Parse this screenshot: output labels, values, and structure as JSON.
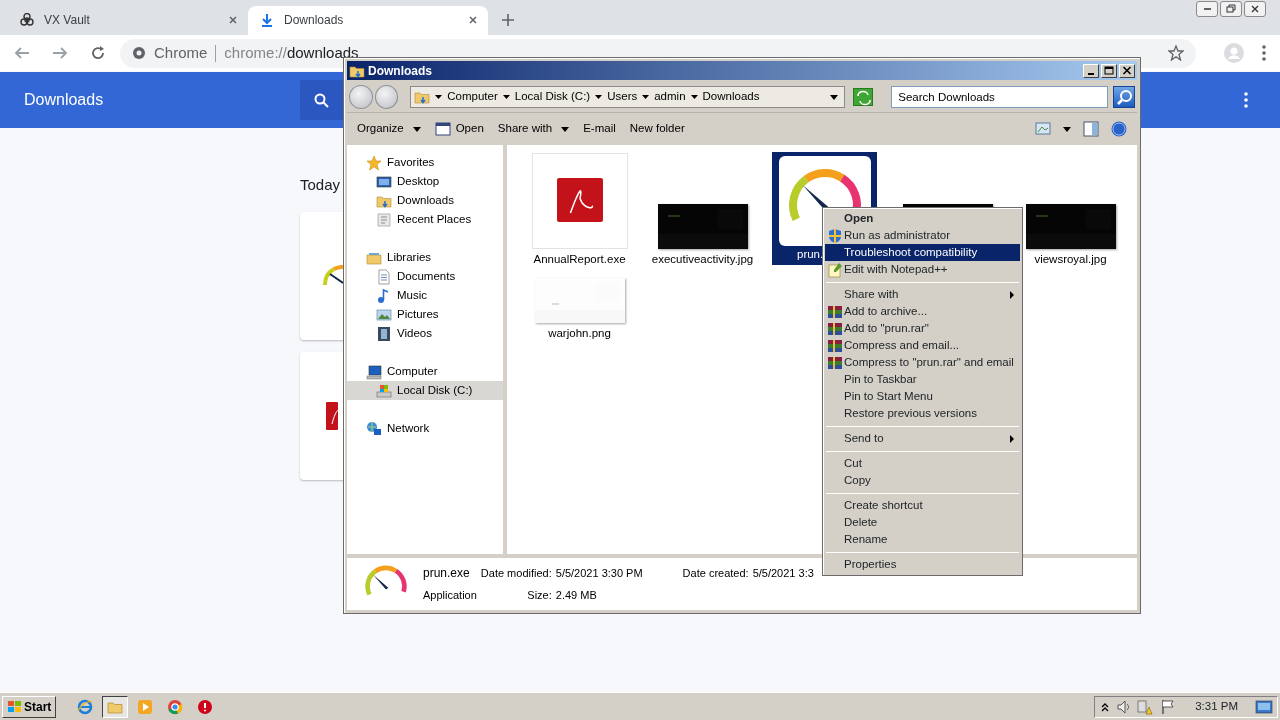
{
  "browser": {
    "tabs": [
      {
        "title": "VX Vault",
        "selected": false
      },
      {
        "title": "Downloads",
        "selected": true
      }
    ],
    "omnibox": {
      "origin": "Chrome",
      "scheme": "chrome://",
      "path": "downloads"
    }
  },
  "downloads_page": {
    "title": "Downloads",
    "section": "Today"
  },
  "explorer": {
    "title": "Downloads",
    "breadcrumb": [
      "Computer",
      "Local Disk (C:)",
      "Users",
      "admin",
      "Downloads"
    ],
    "search": {
      "placeholder": "Search Downloads"
    },
    "commands": [
      {
        "label": "Organize",
        "dropdown": true
      },
      {
        "label": "Open",
        "dropdown": false
      },
      {
        "label": "Share with",
        "dropdown": true
      },
      {
        "label": "E-mail",
        "dropdown": false
      },
      {
        "label": "New folder",
        "dropdown": false
      }
    ],
    "nav": [
      {
        "label": "Favorites",
        "selected": false,
        "children": [
          {
            "label": "Desktop",
            "selected": false
          },
          {
            "label": "Downloads",
            "selected": false
          },
          {
            "label": "Recent Places",
            "selected": false
          }
        ]
      },
      {
        "label": "Libraries",
        "selected": false,
        "children": [
          {
            "label": "Documents",
            "selected": false
          },
          {
            "label": "Music",
            "selected": false
          },
          {
            "label": "Pictures",
            "selected": false
          },
          {
            "label": "Videos",
            "selected": false
          }
        ]
      },
      {
        "label": "Computer",
        "selected": false,
        "children": [
          {
            "label": "Local Disk (C:)",
            "selected": true
          }
        ]
      },
      {
        "label": "Network",
        "selected": false
      }
    ],
    "files": [
      {
        "name": "AnnualReport.exe",
        "selected": false
      },
      {
        "name": "executiveactivity.jpg",
        "selected": false
      },
      {
        "name": "prun.",
        "selected": true
      },
      {
        "selected": false
      },
      {
        "name": "viewsroyal.jpg",
        "selected": false
      },
      {
        "name": "warjohn.png",
        "selected": false
      }
    ],
    "details": {
      "name": "prun.exe",
      "type": "Application",
      "fields": [
        {
          "label": "Date modified:",
          "value": "5/5/2021 3:30 PM"
        },
        {
          "label": "Size:",
          "value": "2.49 MB"
        },
        {
          "label": "Date created:",
          "value": "5/5/2021 3:3"
        }
      ]
    }
  },
  "context_menu": {
    "groups": [
      [
        {
          "label": "Open",
          "default": true,
          "selected": false
        },
        {
          "label": "Run as administrator",
          "selected": false
        },
        {
          "label": "Troubleshoot compatibility",
          "selected": true
        },
        {
          "label": "Edit with Notepad++",
          "selected": false
        }
      ],
      [
        {
          "label": "Share with",
          "submenu": true,
          "selected": false
        },
        {
          "label": "Add to archive...",
          "selected": false
        },
        {
          "label": "Add to \"prun.rar\"",
          "selected": false
        },
        {
          "label": "Compress and email...",
          "selected": false
        },
        {
          "label": "Compress to \"prun.rar\" and email",
          "selected": false
        },
        {
          "label": "Pin to Taskbar",
          "selected": false
        },
        {
          "label": "Pin to Start Menu",
          "selected": false
        },
        {
          "label": "Restore previous versions",
          "selected": false
        }
      ],
      [
        {
          "label": "Send to",
          "submenu": true,
          "selected": false
        }
      ],
      [
        {
          "label": "Cut",
          "selected": false
        },
        {
          "label": "Copy",
          "selected": false
        }
      ],
      [
        {
          "label": "Create shortcut",
          "selected": false
        },
        {
          "label": "Delete",
          "selected": false
        },
        {
          "label": "Rename",
          "selected": false
        }
      ],
      [
        {
          "label": "Properties",
          "selected": false
        }
      ]
    ]
  },
  "taskbar": {
    "start": "Start",
    "apps": [
      {
        "selected": false
      },
      {
        "selected": true
      },
      {
        "selected": false
      },
      {
        "selected": false
      },
      {
        "selected": false
      }
    ],
    "clock": "3:31 PM"
  }
}
